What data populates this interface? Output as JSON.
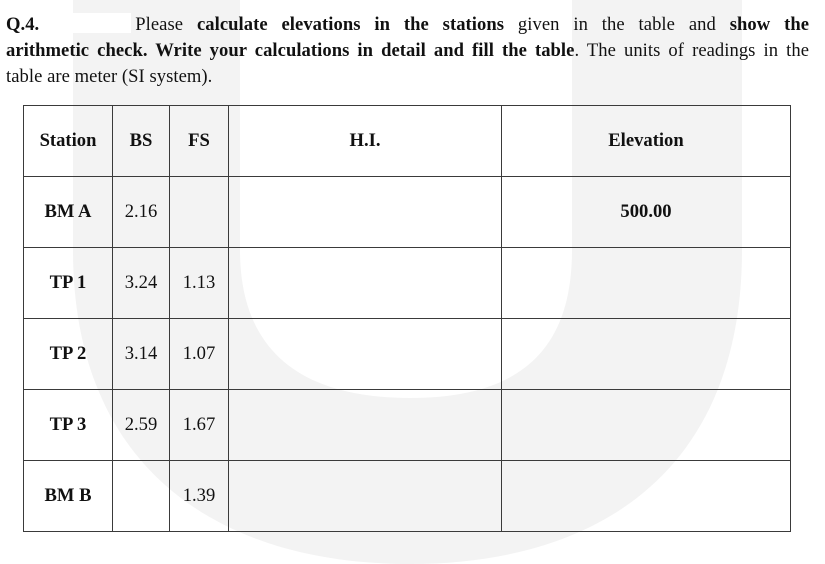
{
  "question": {
    "number": "Q.4.",
    "segments": [
      {
        "text": "Please ",
        "bold": false
      },
      {
        "text": "calculate elevations in the stations",
        "bold": true
      },
      {
        "text": " given in the table and ",
        "bold": false
      },
      {
        "text": "show the arithmetic check. Write your calculations in detail and fill the table",
        "bold": true
      },
      {
        "text": ". The units of readings in the table are meter (SI system).",
        "bold": false
      }
    ],
    "line1": {
      "t1": "Please ",
      "b1": "calculate elevations in the stations",
      "t2": " given in the table and ",
      "b2": "show the"
    },
    "line2": {
      "b1": "arithmetic check. Write your calculations in detail and fill the table",
      "t1": ". The units of readings in the"
    },
    "line3": {
      "t1": "table are meter (SI system)."
    }
  },
  "table": {
    "headers": [
      "Station",
      "BS",
      "FS",
      "H.I.",
      "Elevation"
    ],
    "rows": [
      {
        "station": "BM A",
        "bs": "2.16",
        "fs": "",
        "hi": "",
        "elevation": "500.00"
      },
      {
        "station": "TP 1",
        "bs": "3.24",
        "fs": "1.13",
        "hi": "",
        "elevation": ""
      },
      {
        "station": "TP 2",
        "bs": "3.14",
        "fs": "1.07",
        "hi": "",
        "elevation": ""
      },
      {
        "station": "TP 3",
        "bs": "2.59",
        "fs": "1.67",
        "hi": "",
        "elevation": ""
      },
      {
        "station": "BM B",
        "bs": "",
        "fs": "1.39",
        "hi": "",
        "elevation": ""
      }
    ]
  },
  "colors": {
    "watermark": "#f3f3f3",
    "border": "#3a3a3a",
    "text": "#111111"
  }
}
